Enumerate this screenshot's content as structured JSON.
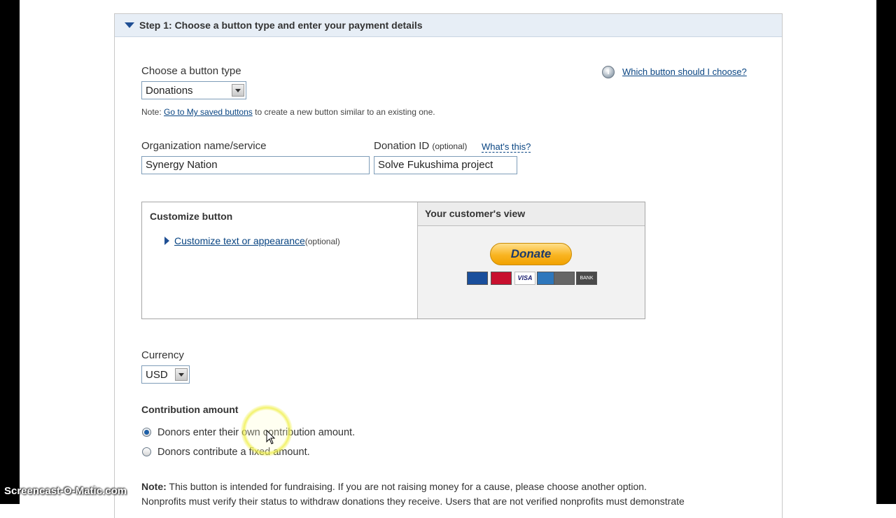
{
  "step_header": "Step 1: Choose a button type and enter your payment details",
  "button_type": {
    "label": "Choose a button type",
    "value": "Donations",
    "help_link": "Which button should I choose?",
    "note_prefix": "Note:",
    "note_link": "Go to My saved buttons",
    "note_suffix": "to create a new button similar to an existing one."
  },
  "organization": {
    "label": "Organization name/service",
    "value": "Synergy Nation"
  },
  "donation_id": {
    "label": "Donation ID",
    "optional": "(optional)",
    "help_link": "What's this?",
    "value": "Solve Fukushima project"
  },
  "customize": {
    "title": "Customize button",
    "link": "Customize text or appearance",
    "optional": "(optional)"
  },
  "preview": {
    "title": "Your customer's view",
    "donate_label": "Donate",
    "cards": [
      {
        "name": "Maestro",
        "color": "#1a4f9c"
      },
      {
        "name": "MasterCard",
        "color": "#c8102e"
      },
      {
        "name": "VISA",
        "color": "#ffffff"
      },
      {
        "name": "AmEx",
        "color": "#2e77bc"
      },
      {
        "name": "Discover",
        "color": "#666666"
      },
      {
        "name": "BANK",
        "color": "#4a4a4a"
      }
    ]
  },
  "currency": {
    "label": "Currency",
    "value": "USD"
  },
  "contribution": {
    "title": "Contribution amount",
    "options": [
      {
        "label": "Donors enter their own contribution amount.",
        "checked": true
      },
      {
        "label": "Donors contribute a fixed amount.",
        "checked": false
      }
    ]
  },
  "footer_note": {
    "prefix": "Note:",
    "line1": "This button is intended for fundraising. If you are not raising money for a cause, please choose another option.",
    "line2": "Nonprofits must verify their status to withdraw donations they receive. Users that are not verified nonprofits must demonstrate"
  },
  "watermark": "Screencast-O-Matic.com"
}
